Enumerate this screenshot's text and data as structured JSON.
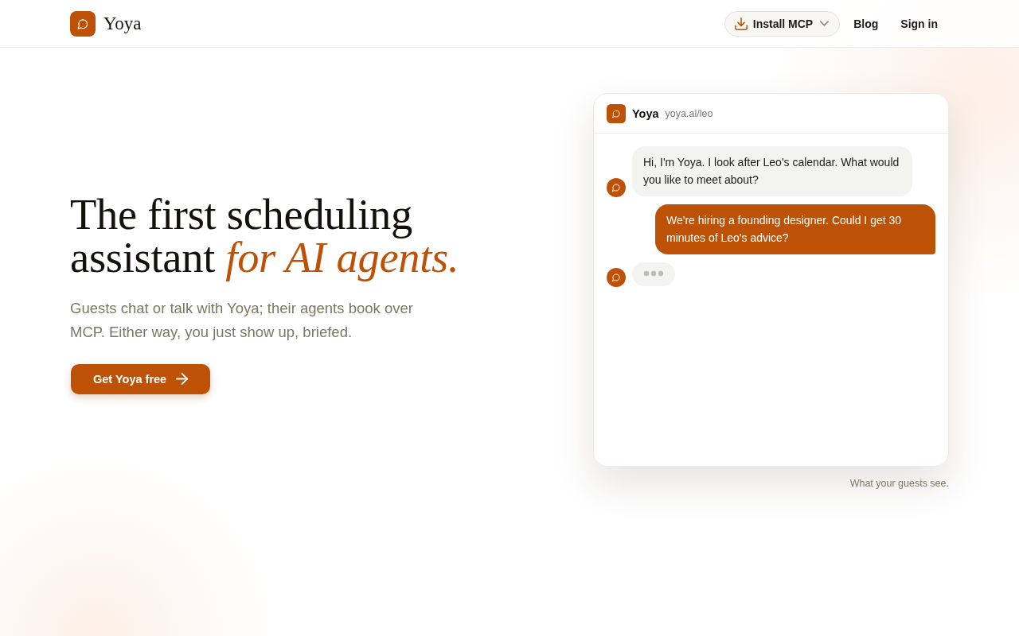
{
  "header": {
    "brand": "Yoya",
    "nav": [
      {
        "kind": "dropdown",
        "label": "Install MCP"
      },
      {
        "kind": "link",
        "label": "Blog"
      },
      {
        "kind": "link",
        "label": "Sign in"
      }
    ]
  },
  "hero": {
    "headline": "The first scheduling assistant *for AI agents.*",
    "subtitle": "Guests chat or talk with Yoya; their agents book over MCP. Either way, you just show up, briefed.",
    "cta": {
      "label": "Get Yoya free"
    }
  },
  "chat_preview": {
    "title": "Yoya",
    "url": "yoya.ai/leo",
    "messages": [
      {
        "kind": "received",
        "text": "Hi, I'm Yoya. I look after Leo's calendar. What would you like to meet about?"
      },
      {
        "kind": "sent",
        "text": "We're hiring a founding designer. Could I get 30 minutes of Leo's advice?"
      },
      {
        "kind": "typing"
      }
    ],
    "caption": "What your guests see."
  }
}
